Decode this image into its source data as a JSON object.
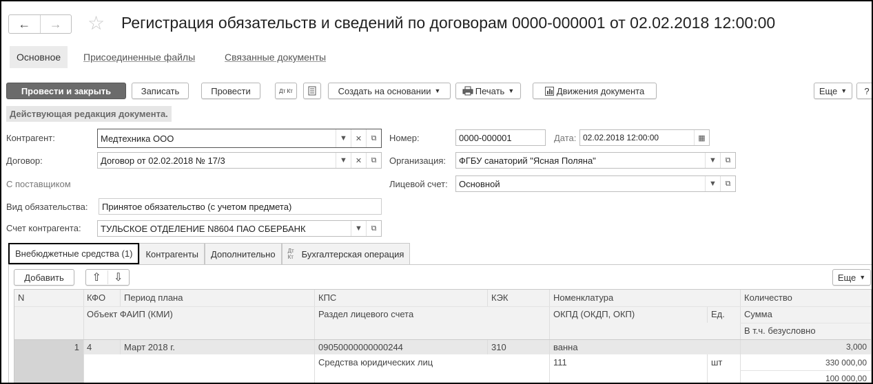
{
  "nav": {
    "back_icon": "←",
    "forward_icon": "→",
    "star_icon": "☆"
  },
  "title": "Регистрация обязательств и сведений по договорам 0000-000001 от 02.02.2018 12:00:00",
  "tabs": {
    "main": "Основное",
    "files": "Присоединенные файлы",
    "docs": "Связанные документы"
  },
  "toolbar": {
    "post_close": "Провести и закрыть",
    "save": "Записать",
    "post": "Провести",
    "dtkt": "Дт Кт",
    "create_based": "Создать на основании",
    "print": "Печать",
    "movements": "Движения документа",
    "more": "Еще",
    "help": "?"
  },
  "notice": "Действующая редакция документа.",
  "form": {
    "contractor_label": "Контрагент:",
    "contractor_value": "Медтехника ООО",
    "number_label": "Номер:",
    "number_value": "0000-000001",
    "date_label": "Дата:",
    "date_value": "02.02.2018 12:00:00",
    "contract_label": "Договор:",
    "contract_value": "Договор от 02.02.2018 № 17/3",
    "org_label": "Организация:",
    "org_value": "ФГБУ санаторий \"Ясная Поляна\"",
    "supplier_note": "С поставщиком",
    "account_label": "Лицевой счет:",
    "account_value": "Основной",
    "obligation_label": "Вид обязательства:",
    "obligation_value": "Принятое обязательство (с учетом предмета)",
    "bank_label": "Счет контрагента:",
    "bank_value": "ТУЛЬСКОЕ ОТДЕЛЕНИЕ N8604 ПАО СБЕРБАНК"
  },
  "subtabs": {
    "funds": "Внебюджетные средства (1)",
    "contractors": "Контрагенты",
    "extra": "Дополнительно",
    "accounting": "Бухгалтерская операция",
    "accounting_icon": "Дт Кт"
  },
  "table_toolbar": {
    "add": "Добавить",
    "up_icon": "⇧",
    "down_icon": "⇩",
    "more": "Еще"
  },
  "table": {
    "headers": {
      "n": "N",
      "kfo": "КФО",
      "period": "Период плана",
      "kps": "КПС",
      "kek": "КЭК",
      "nomenclature": "Номенклатура",
      "quantity": "Количество",
      "object": "Объект ФАИП (КМИ)",
      "section": "Раздел лицевого счета",
      "okpd": "ОКПД (ОКДП, ОКП)",
      "unit": "Ед.",
      "sum": "Сумма",
      "incl": "В т.ч. безусловно"
    },
    "row": {
      "n": "1",
      "kfo": "4",
      "period": "Март 2018 г.",
      "kps": "09050000000000244",
      "kek": "310",
      "nomenclature": "ванна",
      "quantity": "3,000",
      "section": "Средства юридических лиц",
      "okpd": "111",
      "unit": "шт",
      "sum": "330 000,00",
      "incl": "100 000,00"
    }
  }
}
